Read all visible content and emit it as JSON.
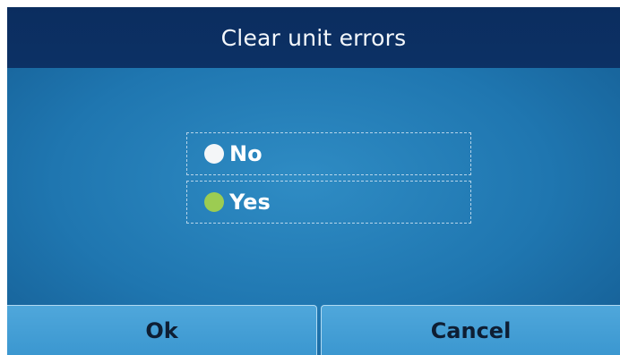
{
  "dialog": {
    "title": "Clear unit errors"
  },
  "options": [
    {
      "label": "No",
      "selected": false,
      "dot_color": "#f4f6f8"
    },
    {
      "label": "Yes",
      "selected": true,
      "dot_color": "#9ccc52"
    }
  ],
  "buttons": {
    "ok_label": "Ok",
    "cancel_label": "Cancel"
  },
  "colors": {
    "title_bar": "#0c3165",
    "background": "#1f76b0",
    "button": "#43a0d6"
  }
}
